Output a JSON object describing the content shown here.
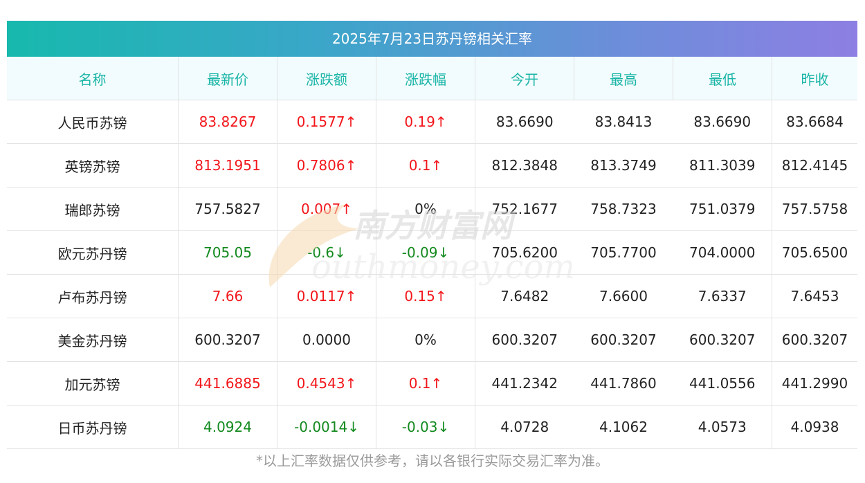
{
  "title": "2025年7月23日苏丹镑相关汇率",
  "columns": [
    "名称",
    "最新价",
    "涨跌额",
    "涨跌幅",
    "今开",
    "最高",
    "最低",
    "昨收"
  ],
  "rows": [
    {
      "name": "人民币苏镑",
      "latest": "83.8267",
      "change": "0.1577↑",
      "pct": "0.19↑",
      "open": "83.6690",
      "high": "83.8413",
      "low": "83.6690",
      "prev": "83.6684",
      "dir": "up"
    },
    {
      "name": "英镑苏镑",
      "latest": "813.1951",
      "change": "0.7806↑",
      "pct": "0.1↑",
      "open": "812.3848",
      "high": "813.3749",
      "low": "811.3039",
      "prev": "812.4145",
      "dir": "up"
    },
    {
      "name": "瑞郎苏镑",
      "latest": "757.5827",
      "change": "0.007↑",
      "pct": "0%",
      "open": "752.1677",
      "high": "758.7323",
      "low": "751.0379",
      "prev": "757.5758",
      "dir": "mixed"
    },
    {
      "name": "欧元苏丹镑",
      "latest": "705.05",
      "change": "-0.6↓",
      "pct": "-0.09↓",
      "open": "705.6200",
      "high": "705.7700",
      "low": "704.0000",
      "prev": "705.6500",
      "dir": "down"
    },
    {
      "name": "卢布苏丹镑",
      "latest": "7.66",
      "change": "0.0117↑",
      "pct": "0.15↑",
      "open": "7.6482",
      "high": "7.6600",
      "low": "7.6337",
      "prev": "7.6453",
      "dir": "up"
    },
    {
      "name": "美金苏丹镑",
      "latest": "600.3207",
      "change": "0.0000",
      "pct": "0%",
      "open": "600.3207",
      "high": "600.3207",
      "low": "600.3207",
      "prev": "600.3207",
      "dir": "flat"
    },
    {
      "name": "加元苏镑",
      "latest": "441.6885",
      "change": "0.4543↑",
      "pct": "0.1↑",
      "open": "441.2342",
      "high": "441.7860",
      "low": "441.0556",
      "prev": "441.2990",
      "dir": "up"
    },
    {
      "name": "日币苏丹镑",
      "latest": "4.0924",
      "change": "-0.0014↓",
      "pct": "-0.03↓",
      "open": "4.0728",
      "high": "4.1062",
      "low": "4.0573",
      "prev": "4.0938",
      "dir": "down"
    }
  ],
  "footnote": "*以上汇率数据仅供参考，请以各银行实际交易汇率为准。",
  "watermark": {
    "cn": "南方财富网",
    "en": "outhmoney.com"
  },
  "colors": {
    "up": "#f2161b",
    "down": "#138a1e",
    "header_text": "#19b5a7"
  }
}
